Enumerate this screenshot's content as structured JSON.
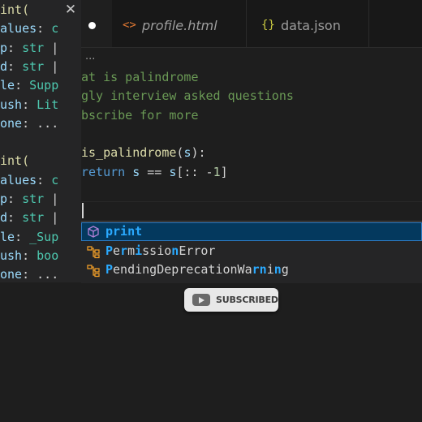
{
  "colors": {
    "keyword": "#569cd6",
    "type": "#4ec9b0",
    "param": "#9cdcfe",
    "comment": "#6a9955",
    "number": "#b5cea8",
    "function": "#dcdcaa",
    "text": "#d4d4d4",
    "highlight": "#2aaaff",
    "tab_html_icon": "#e37933",
    "tab_json_icon": "#cbcb41"
  },
  "hover_panel": {
    "close_glyph": "✕",
    "lines": [
      {
        "tokens": [
          {
            "t": "int(",
            "c": "function"
          }
        ]
      },
      {
        "tokens": [
          {
            "t": "alues",
            "c": "param"
          },
          {
            "t": ": ",
            "c": "text"
          },
          {
            "t": "c",
            "c": "type"
          }
        ]
      },
      {
        "tokens": [
          {
            "t": "p",
            "c": "param"
          },
          {
            "t": ": ",
            "c": "text"
          },
          {
            "t": "str",
            "c": "type"
          },
          {
            "t": " |",
            "c": "text"
          }
        ]
      },
      {
        "tokens": [
          {
            "t": "d",
            "c": "param"
          },
          {
            "t": ": ",
            "c": "text"
          },
          {
            "t": "str",
            "c": "type"
          },
          {
            "t": " |",
            "c": "text"
          }
        ]
      },
      {
        "tokens": [
          {
            "t": "le",
            "c": "param"
          },
          {
            "t": ": ",
            "c": "text"
          },
          {
            "t": "Supp",
            "c": "type"
          }
        ]
      },
      {
        "tokens": [
          {
            "t": "ush",
            "c": "param"
          },
          {
            "t": ": ",
            "c": "text"
          },
          {
            "t": "Lit",
            "c": "type"
          }
        ]
      },
      {
        "tokens": [
          {
            "t": "one",
            "c": "param"
          },
          {
            "t": ": ...",
            "c": "text"
          }
        ]
      },
      {
        "tokens": []
      },
      {
        "tokens": [
          {
            "t": "int(",
            "c": "function"
          }
        ]
      },
      {
        "tokens": [
          {
            "t": "alues",
            "c": "param"
          },
          {
            "t": ": ",
            "c": "text"
          },
          {
            "t": "c",
            "c": "type"
          }
        ]
      },
      {
        "tokens": [
          {
            "t": "p",
            "c": "param"
          },
          {
            "t": ": ",
            "c": "text"
          },
          {
            "t": "str",
            "c": "type"
          },
          {
            "t": " |",
            "c": "text"
          }
        ]
      },
      {
        "tokens": [
          {
            "t": "d",
            "c": "param"
          },
          {
            "t": ": ",
            "c": "text"
          },
          {
            "t": "str",
            "c": "type"
          },
          {
            "t": " |",
            "c": "text"
          }
        ]
      },
      {
        "tokens": [
          {
            "t": "le",
            "c": "param"
          },
          {
            "t": ": ",
            "c": "text"
          },
          {
            "t": "_Sup",
            "c": "type"
          }
        ]
      },
      {
        "tokens": [
          {
            "t": "ush",
            "c": "param"
          },
          {
            "t": ": ",
            "c": "text"
          },
          {
            "t": "boo",
            "c": "type"
          }
        ]
      },
      {
        "tokens": [
          {
            "t": "one",
            "c": "param"
          },
          {
            "t": ": ...",
            "c": "text"
          }
        ]
      }
    ]
  },
  "tabs": [
    {
      "label": "",
      "icon": "modified-dot-icon",
      "active": true
    },
    {
      "label": "profile.html",
      "icon_glyph": "<>",
      "icon": "html-file-icon"
    },
    {
      "label": "data.json",
      "icon_glyph": "{}",
      "icon": "json-file-icon"
    }
  ],
  "editor": {
    "breadcrumb": "...",
    "lines": [
      {
        "tokens": [
          {
            "t": "at is palindrome",
            "c": "comment"
          }
        ]
      },
      {
        "tokens": [
          {
            "t": "gly interview asked questions",
            "c": "comment"
          }
        ]
      },
      {
        "tokens": [
          {
            "t": "bscribe for more",
            "c": "comment"
          }
        ]
      },
      {
        "tokens": []
      },
      {
        "tokens": [
          {
            "t": "is_palindrome",
            "c": "function"
          },
          {
            "t": "(",
            "c": "text"
          },
          {
            "t": "s",
            "c": "param"
          },
          {
            "t": "):",
            "c": "text"
          }
        ]
      },
      {
        "tokens": [
          {
            "t": "return",
            "c": "keyword"
          },
          {
            "t": " ",
            "c": "text"
          },
          {
            "t": "s",
            "c": "param"
          },
          {
            "t": " == ",
            "c": "text"
          },
          {
            "t": "s",
            "c": "param"
          },
          {
            "t": "[:: -",
            "c": "text"
          },
          {
            "t": "1",
            "c": "number"
          },
          {
            "t": "]",
            "c": "text"
          }
        ]
      }
    ]
  },
  "suggestions": [
    {
      "icon": "function-cube-icon",
      "selected": true,
      "parts": [
        {
          "t": "print",
          "hl": true
        }
      ]
    },
    {
      "icon": "class-icon",
      "selected": false,
      "parts": [
        {
          "t": "P",
          "hl": true
        },
        {
          "t": "e",
          "hl": false
        },
        {
          "t": "r",
          "hl": true
        },
        {
          "t": "m",
          "hl": false
        },
        {
          "t": "i",
          "hl": true
        },
        {
          "t": "ssio",
          "hl": false
        },
        {
          "t": "n",
          "hl": true
        },
        {
          "t": "Error",
          "hl": false
        }
      ]
    },
    {
      "icon": "class-icon",
      "selected": false,
      "parts": [
        {
          "t": "P",
          "hl": true
        },
        {
          "t": "endingDeprecationWa",
          "hl": false
        },
        {
          "t": "rn",
          "hl": true
        },
        {
          "t": "i",
          "hl": false
        },
        {
          "t": "n",
          "hl": true
        },
        {
          "t": "g",
          "hl": false
        }
      ]
    }
  ],
  "subscribed_label": "SUBSCRIBED"
}
